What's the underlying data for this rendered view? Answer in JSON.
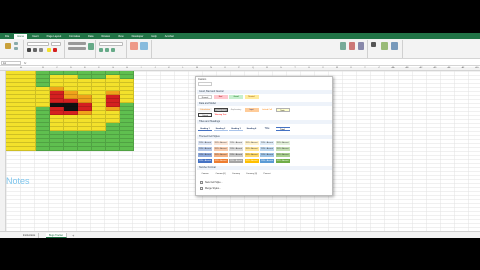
{
  "ribbon": {
    "tabs": [
      "File",
      "Home",
      "Insert",
      "Page Layout",
      "Formulas",
      "Data",
      "Review",
      "View",
      "Developer",
      "Help",
      "Acrobat"
    ],
    "active_tab": 1
  },
  "formula_bar": {
    "name_box": "A1",
    "fx": "fx"
  },
  "columns": [
    "A",
    "B",
    "C",
    "D",
    "E",
    "F",
    "G",
    "H",
    "I",
    "J",
    "K",
    "L",
    "M",
    "N",
    "O",
    "P",
    "Q",
    "R",
    "S",
    "T",
    "U",
    "V",
    "W",
    "X",
    "Y",
    "Z",
    "AA",
    "AB",
    "AC",
    "AD",
    "AE",
    "AF",
    "AG"
  ],
  "notes_label": "Notes",
  "sheet_tabs": [
    "Instructions",
    "Bugs Tracker"
  ],
  "active_sheet": 1,
  "add_sheet": "+",
  "colors": {
    "excel_green": "#217346",
    "heat_green": "#5fbf4f",
    "heat_yellow": "#f3e12b",
    "heat_orange": "#f0a21b",
    "heat_red": "#d42020",
    "heat_black": "#111111"
  },
  "heatmap_rows": [
    [
      "d",
      "g",
      "g",
      "g",
      "g",
      "g",
      "g",
      "g"
    ],
    [
      "d",
      "g",
      "y",
      "y",
      "g",
      "g",
      "y",
      "g"
    ],
    [
      "d",
      "g",
      "y",
      "y",
      "y",
      "y",
      "y",
      "y"
    ],
    [
      "d",
      "g",
      "y",
      "y",
      "y",
      "y",
      "y",
      "y"
    ],
    [
      "d",
      "y",
      "o",
      "y",
      "y",
      "y",
      "y",
      "y"
    ],
    [
      "d",
      "y",
      "r",
      "o",
      "y",
      "y",
      "o",
      "y"
    ],
    [
      "d",
      "y",
      "r",
      "o",
      "o",
      "y",
      "r",
      "y"
    ],
    [
      "d",
      "y",
      "r",
      "r",
      "o",
      "y",
      "r",
      "y"
    ],
    [
      "d",
      "y",
      "k",
      "k",
      "r",
      "y",
      "r",
      "g"
    ],
    [
      "d",
      "g",
      "r",
      "k",
      "r",
      "y",
      "o",
      "g"
    ],
    [
      "d",
      "g",
      "r",
      "r",
      "o",
      "y",
      "y",
      "g"
    ],
    [
      "d",
      "g",
      "y",
      "y",
      "y",
      "y",
      "y",
      "g"
    ],
    [
      "d",
      "g",
      "y",
      "y",
      "y",
      "y",
      "y",
      "g"
    ],
    [
      "d",
      "g",
      "y",
      "y",
      "y",
      "y",
      "g",
      "g"
    ],
    [
      "d",
      "g",
      "y",
      "y",
      "y",
      "y",
      "g",
      "g"
    ],
    [
      "d",
      "g",
      "g",
      "g",
      "g",
      "g",
      "g",
      "g"
    ],
    [
      "d",
      "g",
      "g",
      "g",
      "g",
      "g",
      "g",
      "g"
    ],
    [
      "d",
      "g",
      "g",
      "g",
      "g",
      "g",
      "g",
      "g"
    ],
    [
      "d",
      "g",
      "g",
      "g",
      "g",
      "g",
      "g",
      "g"
    ],
    [
      "d",
      "g",
      "g",
      "g",
      "g",
      "g",
      "g",
      "g"
    ]
  ],
  "gallery": {
    "title": "Custom",
    "sections": {
      "good_bad": "Good, Bad and Neutral",
      "data_model": "Data and Model",
      "titles": "Titles and Headings",
      "themed": "Themed Cell Styles",
      "number": "Number Format"
    },
    "good_bad_items": [
      "Normal",
      "Bad",
      "Good",
      "Neutral"
    ],
    "data_model_items": [
      "Calculation",
      "Check Cell",
      "Explanatory",
      "Input",
      "Linked Cell",
      "Note"
    ],
    "data_model_row2": [
      "Output",
      "Warning Text"
    ],
    "titles_items": [
      "Heading 1",
      "Heading 2",
      "Heading 3",
      "Heading 4",
      "Title",
      "Total"
    ],
    "themed_label": "20% - Accent",
    "number_items": [
      "Comma",
      "Comma [0]",
      "Currency",
      "Currency [0]",
      "Percent"
    ],
    "menu": [
      "New Cell Style...",
      "Merge Styles..."
    ]
  }
}
